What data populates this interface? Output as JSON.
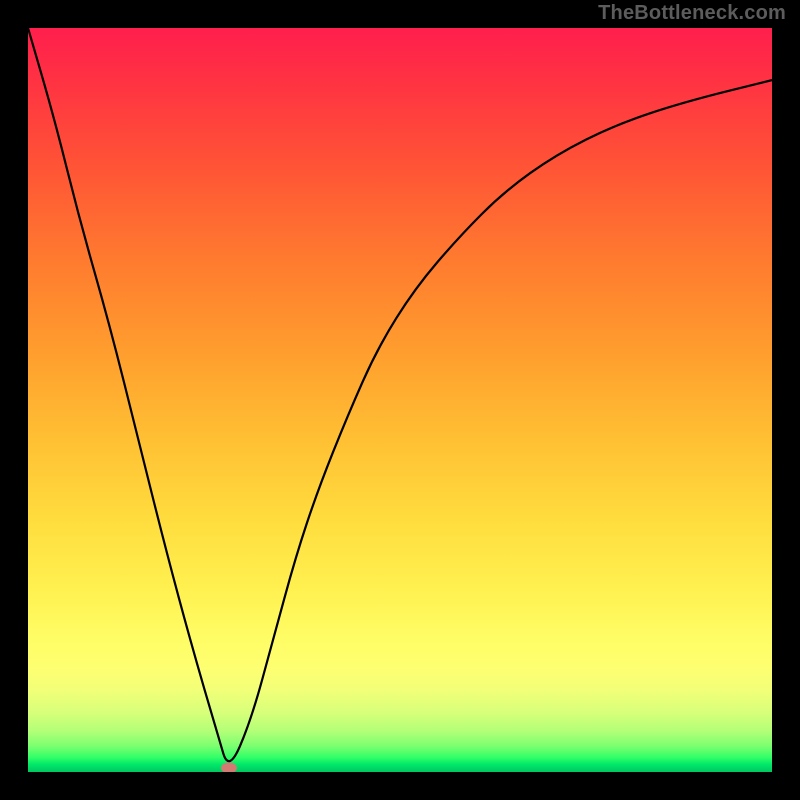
{
  "attribution_text": "TheBottleneck.com",
  "colors": {
    "frame_background": "#000000",
    "curve_stroke": "#000000",
    "trough_dot": "#d37b72",
    "attribution": "#5c5c5c"
  },
  "chart_data": {
    "type": "line",
    "title": "",
    "xlabel": "",
    "ylabel": "",
    "xlim": [
      0,
      100
    ],
    "ylim": [
      0,
      100
    ],
    "grid": false,
    "legend": false,
    "series": [
      {
        "name": "bottleneck-curve",
        "x": [
          0,
          3.5,
          7,
          11,
          15,
          18.5,
          22,
          25.5,
          27,
          30,
          33,
          36,
          39,
          43,
          47,
          52,
          58,
          64,
          71,
          79,
          88,
          100
        ],
        "y": [
          100,
          88,
          74,
          60,
          44,
          30,
          17,
          5,
          0,
          7,
          18,
          29,
          38,
          48,
          57,
          65,
          72,
          78,
          83,
          87,
          90,
          93
        ]
      }
    ],
    "annotations": [
      {
        "name": "trough-marker",
        "x": 27,
        "y": 0
      }
    ]
  }
}
